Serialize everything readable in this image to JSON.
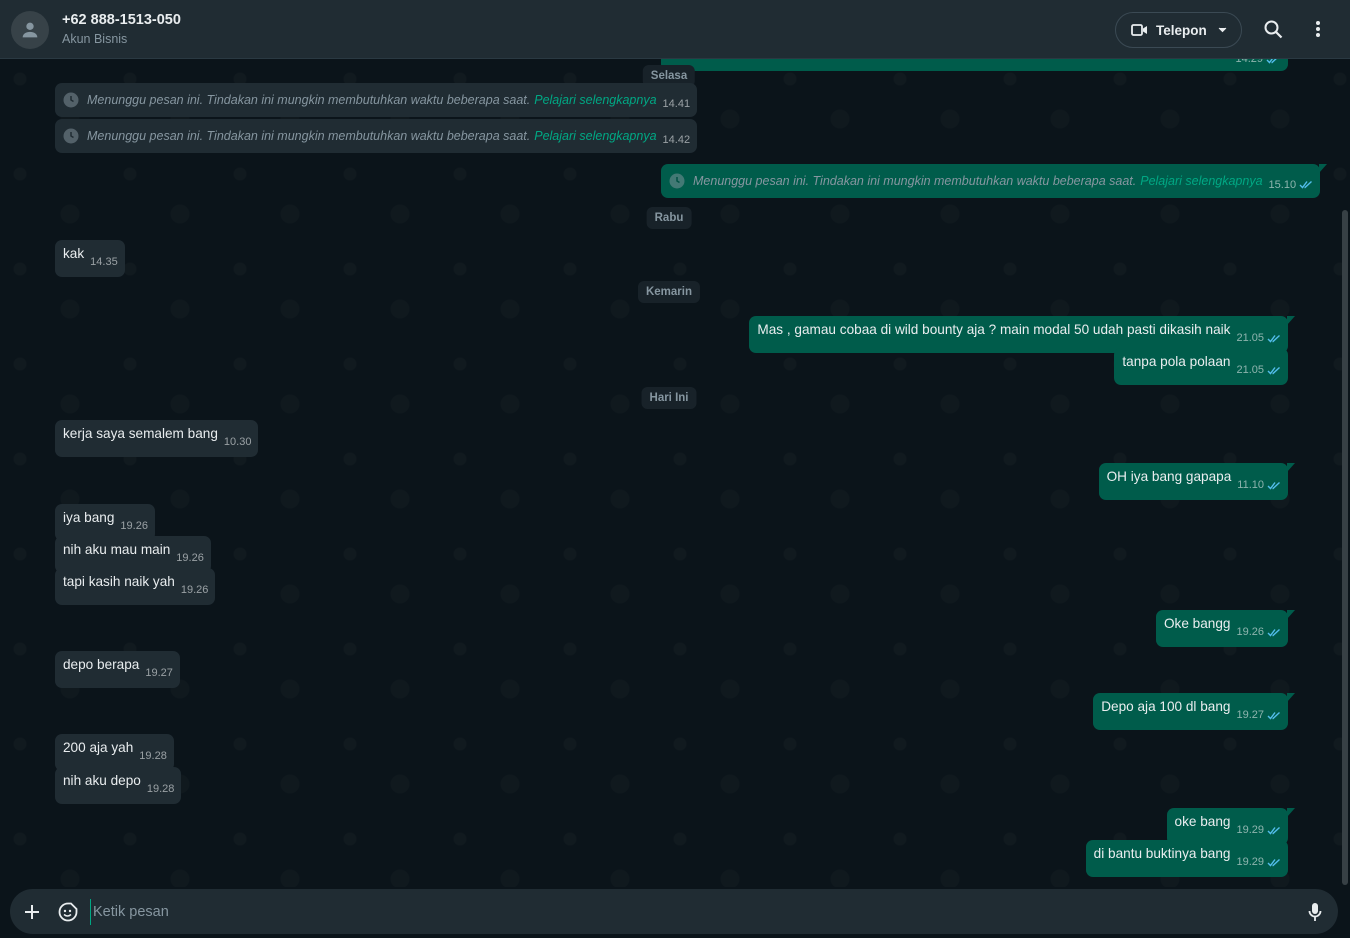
{
  "header": {
    "contact_name": "+62 888-1513-050",
    "contact_sub": "Akun Bisnis",
    "call_label": "Telepon"
  },
  "icons": {
    "avatar": "person-icon",
    "video": "video-camera-icon",
    "caret": "chevron-down-icon",
    "search": "search-icon",
    "menu": "more-vertical-icon",
    "pending": "clock-icon",
    "attach": "plus-icon",
    "sticker": "sticker-icon",
    "mic": "microphone-icon",
    "read": "double-check-icon"
  },
  "colors": {
    "bg": "#0b141a",
    "header": "#202c33",
    "incoming": "#202c33",
    "outgoing": "#005c4b",
    "link": "#00a884",
    "read_ticks": "#53bdeb"
  },
  "chat": {
    "dates": {
      "d1": "Selasa",
      "d2": "Rabu",
      "d3": "Kemarin",
      "d4": "Hari Ini"
    },
    "partial_top_time": "14.29",
    "system_messages": [
      {
        "text": "Menunggu pesan ini. Tindakan ini mungkin membutuhkan waktu beberapa saat.",
        "link": "Pelajari selengkapnya",
        "time": "14.41"
      },
      {
        "text": "Menunggu pesan ini. Tindakan ini mungkin membutuhkan waktu beberapa saat.",
        "link": "Pelajari selengkapnya",
        "time": "14.42"
      },
      {
        "text": "Menunggu pesan ini. Tindakan ini mungkin membutuhkan waktu beberapa saat.",
        "link": "Pelajari selengkapnya",
        "time": "15.10"
      }
    ],
    "messages": [
      {
        "text": "kak",
        "time": "14.35"
      },
      {
        "text": "Mas , gamau cobaa di wild bounty aja ? main modal 50 udah pasti dikasih naik",
        "time": "21.05"
      },
      {
        "text": "tanpa pola polaan",
        "time": "21.05"
      },
      {
        "text": "kerja saya semalem bang",
        "time": "10.30"
      },
      {
        "text": "OH iya bang gapapa",
        "time": "11.10"
      },
      {
        "text": "iya bang",
        "time": "19.26"
      },
      {
        "text": "nih aku mau main",
        "time": "19.26"
      },
      {
        "text": "tapi kasih naik yah",
        "time": "19.26"
      },
      {
        "text": "Oke bangg",
        "time": "19.26"
      },
      {
        "text": "depo berapa",
        "time": "19.27"
      },
      {
        "text": "Depo aja 100 dl bang",
        "time": "19.27"
      },
      {
        "text": "200 aja yah",
        "time": "19.28"
      },
      {
        "text": "nih aku depo",
        "time": "19.28"
      },
      {
        "text": "oke bang",
        "time": "19.29"
      },
      {
        "text": "di bantu buktinya bang",
        "time": "19.29"
      }
    ]
  },
  "composer": {
    "placeholder": "Ketik pesan"
  }
}
